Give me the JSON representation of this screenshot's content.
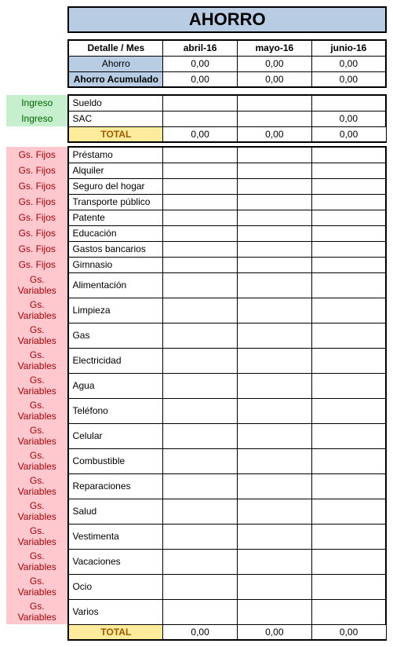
{
  "title": "AHORRO",
  "header": {
    "detalle": "Detalle / Mes",
    "months": [
      "abril-16",
      "mayo-16",
      "junio-16"
    ]
  },
  "ahorro": {
    "label": "Ahorro",
    "values": [
      "0,00",
      "0,00",
      "0,00"
    ]
  },
  "acumulado": {
    "label": "Ahorro Acumulado",
    "values": [
      "0,00",
      "0,00",
      "0,00"
    ]
  },
  "ingreso": {
    "cat": "Ingreso",
    "rows": [
      {
        "label": "Sueldo",
        "values": [
          "",
          "",
          ""
        ]
      },
      {
        "label": "SAC",
        "values": [
          "",
          "",
          "0,00"
        ]
      }
    ],
    "total": {
      "label": "TOTAL",
      "values": [
        "0,00",
        "0,00",
        "0,00"
      ]
    }
  },
  "gastos": {
    "fijos_cat": "Gs. Fijos",
    "variables_cat": "Gs. Variables",
    "rows": [
      {
        "cat": "fijos",
        "label": "Préstamo",
        "values": [
          "",
          "",
          ""
        ]
      },
      {
        "cat": "fijos",
        "label": "Alquiler",
        "values": [
          "",
          "",
          ""
        ]
      },
      {
        "cat": "fijos",
        "label": "Seguro del hogar",
        "values": [
          "",
          "",
          ""
        ]
      },
      {
        "cat": "fijos",
        "label": "Transporte público",
        "values": [
          "",
          "",
          ""
        ]
      },
      {
        "cat": "fijos",
        "label": "Patente",
        "values": [
          "",
          "",
          ""
        ]
      },
      {
        "cat": "fijos",
        "label": "Educación",
        "values": [
          "",
          "",
          ""
        ]
      },
      {
        "cat": "fijos",
        "label": "Gastos bancarios",
        "values": [
          "",
          "",
          ""
        ]
      },
      {
        "cat": "fijos",
        "label": "Gimnasio",
        "values": [
          "",
          "",
          ""
        ]
      },
      {
        "cat": "variables",
        "label": "Alimentación",
        "values": [
          "",
          "",
          ""
        ]
      },
      {
        "cat": "variables",
        "label": "Limpieza",
        "values": [
          "",
          "",
          ""
        ]
      },
      {
        "cat": "variables",
        "label": "Gas",
        "values": [
          "",
          "",
          ""
        ]
      },
      {
        "cat": "variables",
        "label": "Electricidad",
        "values": [
          "",
          "",
          ""
        ]
      },
      {
        "cat": "variables",
        "label": "Agua",
        "values": [
          "",
          "",
          ""
        ]
      },
      {
        "cat": "variables",
        "label": "Teléfono",
        "values": [
          "",
          "",
          ""
        ]
      },
      {
        "cat": "variables",
        "label": "Celular",
        "values": [
          "",
          "",
          ""
        ]
      },
      {
        "cat": "variables",
        "label": "Combustible",
        "values": [
          "",
          "",
          ""
        ]
      },
      {
        "cat": "variables",
        "label": "Reparaciones",
        "values": [
          "",
          "",
          ""
        ]
      },
      {
        "cat": "variables",
        "label": "Salud",
        "values": [
          "",
          "",
          ""
        ]
      },
      {
        "cat": "variables",
        "label": "Vestimenta",
        "values": [
          "",
          "",
          ""
        ]
      },
      {
        "cat": "variables",
        "label": "Vacaciones",
        "values": [
          "",
          "",
          ""
        ]
      },
      {
        "cat": "variables",
        "label": "Ocio",
        "values": [
          "",
          "",
          ""
        ]
      },
      {
        "cat": "variables",
        "label": "Varios",
        "values": [
          "",
          "",
          ""
        ]
      }
    ],
    "total": {
      "label": "TOTAL",
      "values": [
        "0,00",
        "0,00",
        "0,00"
      ]
    }
  }
}
